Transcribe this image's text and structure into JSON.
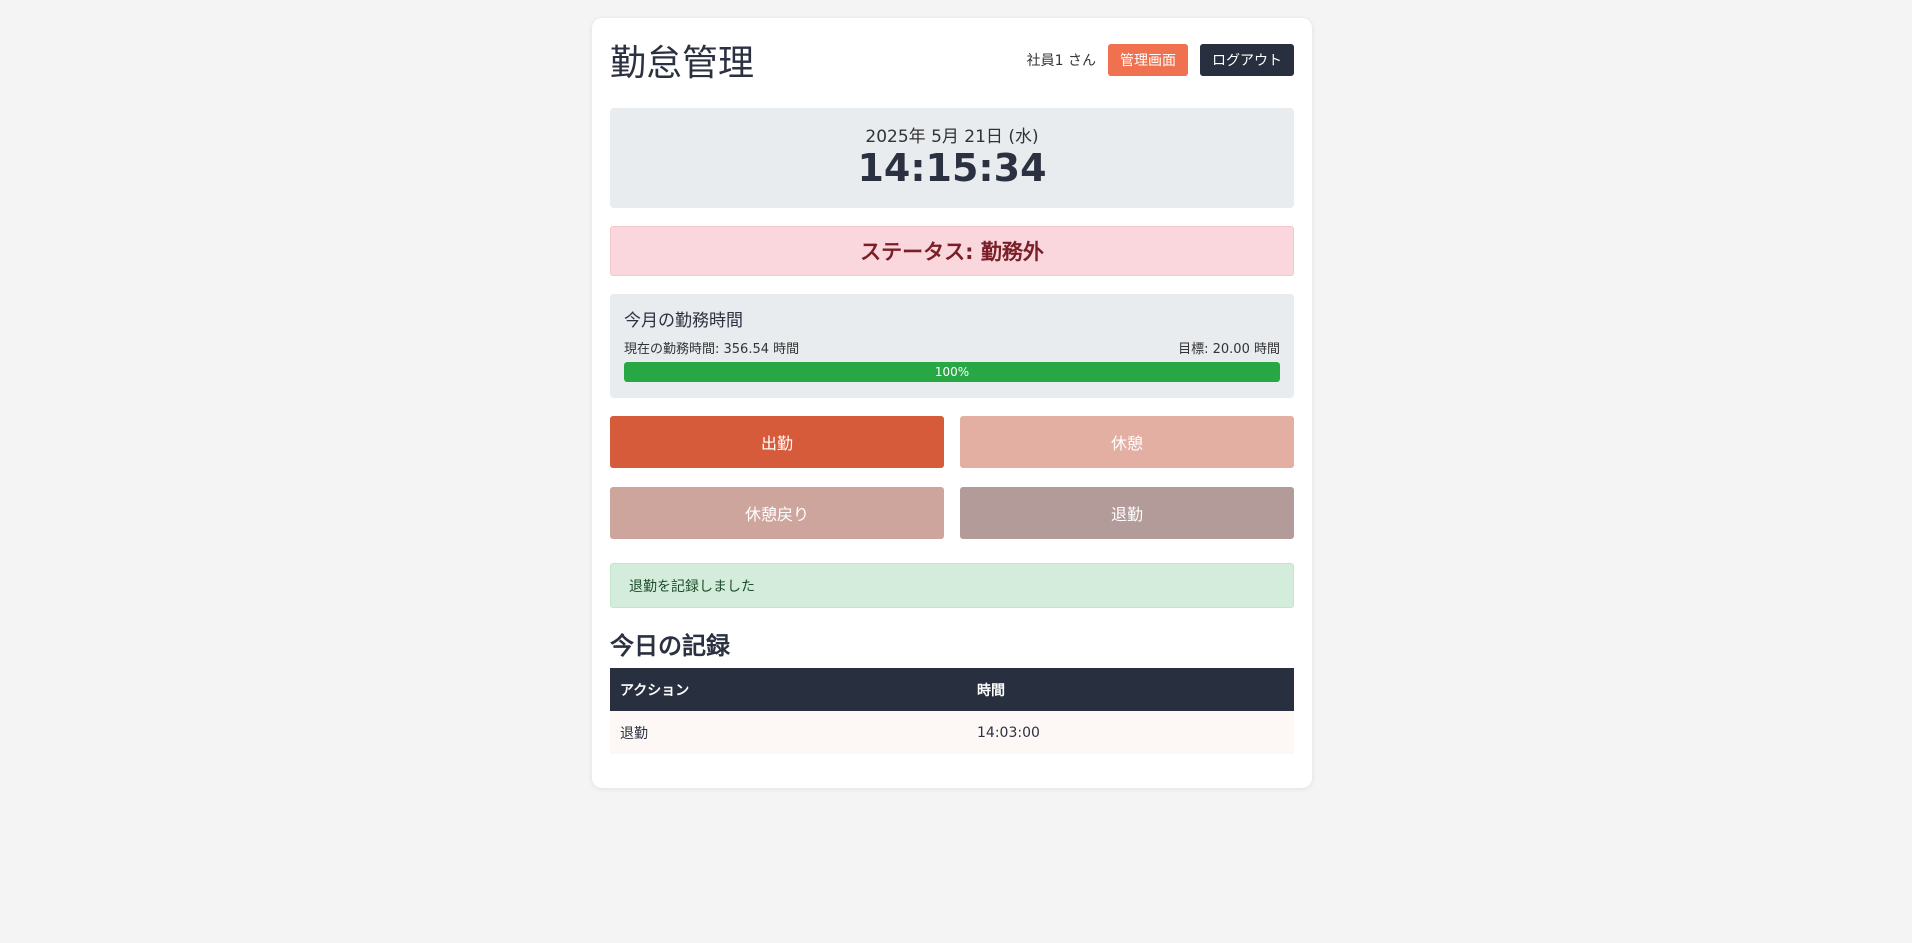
{
  "header": {
    "title": "勤怠管理",
    "user": "社員1 さん",
    "admin_label": "管理画面",
    "logout_label": "ログアウト"
  },
  "clock": {
    "date": "2025年 5月 21日 (水)",
    "time": "14:15:34"
  },
  "status": {
    "text": "ステータス: 勤務外"
  },
  "monthly_hours": {
    "title": "今月の勤務時間",
    "current": "現在の勤務時間: 356.54 時間",
    "target": "目標: 20.00 時間",
    "progress_label": "100%",
    "progress_percent": 100
  },
  "actions": {
    "clock_in": "出勤",
    "break": "休憩",
    "break_return": "休憩戻り",
    "clock_out": "退勤"
  },
  "alert": {
    "message": "退勤を記録しました"
  },
  "records": {
    "title": "今日の記録",
    "headers": [
      "アクション",
      "時間"
    ],
    "rows": [
      {
        "action": "退勤",
        "time": "14:03:00"
      }
    ]
  },
  "colors": {
    "accent": "#d65b3a",
    "admin": "#f07150",
    "dark": "#28303f",
    "progress": "#28a745"
  }
}
